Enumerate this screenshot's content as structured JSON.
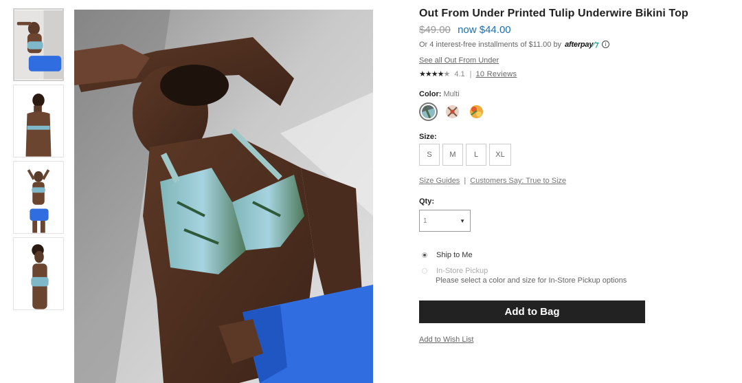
{
  "product": {
    "title": "Out From Under Printed Tulip Underwire Bikini Top",
    "price_old": "$49.00",
    "price_now": "now $44.00",
    "installments_text": "Or 4 interest-free installments of $11.00 by",
    "afterpay_logo": "afterpay",
    "info_icon": "i",
    "brand_link": "See all Out From Under",
    "rating_stars": "★★★★",
    "rating_half": "★",
    "rating_value": "4.1",
    "rating_separator": "|",
    "reviews_link": "10 Reviews"
  },
  "color": {
    "label": "Color:",
    "value": "Multi",
    "swatches": [
      "multi",
      "print-2",
      "print-3"
    ]
  },
  "size": {
    "label": "Size:",
    "options": [
      "S",
      "M",
      "L",
      "XL"
    ]
  },
  "links": {
    "size_guides": "Size Guides",
    "separator": "|",
    "customers_say": "Customers Say: True to Size"
  },
  "qty": {
    "label": "Qty:",
    "value": "1",
    "arrow": "▼"
  },
  "shipping": {
    "ship_to_me": "Ship to Me",
    "in_store": "In-Store Pickup",
    "in_store_note": "Please select a color and size for In-Store Pickup options"
  },
  "actions": {
    "add_to_bag": "Add to Bag",
    "wishlist": "Add to Wish List"
  },
  "colors": {
    "price_accent": "#1a6fb3",
    "button_bg": "#222222",
    "bikini_blue": "#2f6de0"
  }
}
